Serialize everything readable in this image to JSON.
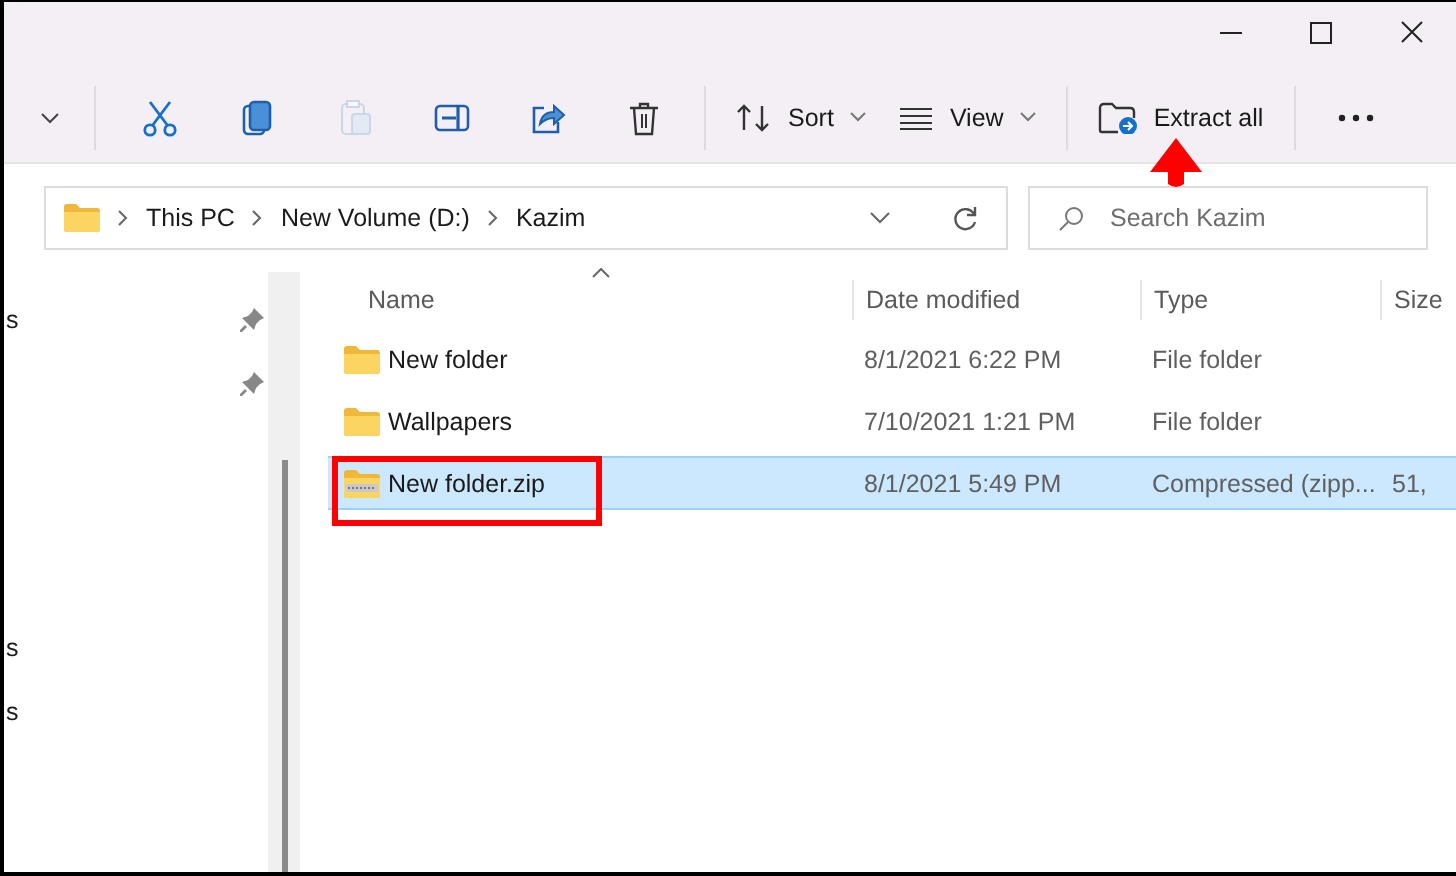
{
  "toolbar": {
    "items": [
      {
        "kind": "new-caret",
        "disabled": false
      },
      {
        "kind": "separator"
      },
      {
        "kind": "cut",
        "disabled": false
      },
      {
        "kind": "copy",
        "disabled": false
      },
      {
        "kind": "paste",
        "disabled": true
      },
      {
        "kind": "rename",
        "disabled": false
      },
      {
        "kind": "share",
        "disabled": false
      },
      {
        "kind": "delete",
        "disabled": false
      },
      {
        "kind": "separator"
      },
      {
        "kind": "sort",
        "label": "Sort",
        "disabled": false
      },
      {
        "kind": "view",
        "label": "View",
        "disabled": false
      },
      {
        "kind": "separator"
      },
      {
        "kind": "extract",
        "label": "Extract all",
        "disabled": false
      },
      {
        "kind": "separator"
      },
      {
        "kind": "more",
        "disabled": false
      }
    ]
  },
  "address": {
    "breadcrumbs": [
      "This PC",
      "New Volume (D:)",
      "Kazim"
    ]
  },
  "search": {
    "placeholder": "Search Kazim"
  },
  "sidebar": {
    "items": [
      {
        "label": "s",
        "pinned": true
      },
      {
        "pinned": true
      },
      {
        "label": "s",
        "pinned": false
      },
      {
        "label": "s",
        "pinned": false
      }
    ]
  },
  "file_list": {
    "columns": [
      {
        "label": "Name",
        "sorted": true
      },
      {
        "label": "Date modified",
        "sorted": false
      },
      {
        "label": "Type",
        "sorted": false
      },
      {
        "label": "Size",
        "sorted": false
      }
    ],
    "rows": [
      {
        "kind": "folder",
        "name": "New folder",
        "date": "8/1/2021 6:22 PM",
        "type": "File folder",
        "selected": false
      },
      {
        "kind": "folder",
        "name": "Wallpapers",
        "date": "7/10/2021 1:21 PM",
        "type": "File folder",
        "selected": false
      },
      {
        "kind": "zip",
        "name": "New folder.zip",
        "date": "8/1/2021 5:49 PM",
        "type": "Compressed (zipp...",
        "size": "51,",
        "selected": true
      }
    ]
  }
}
